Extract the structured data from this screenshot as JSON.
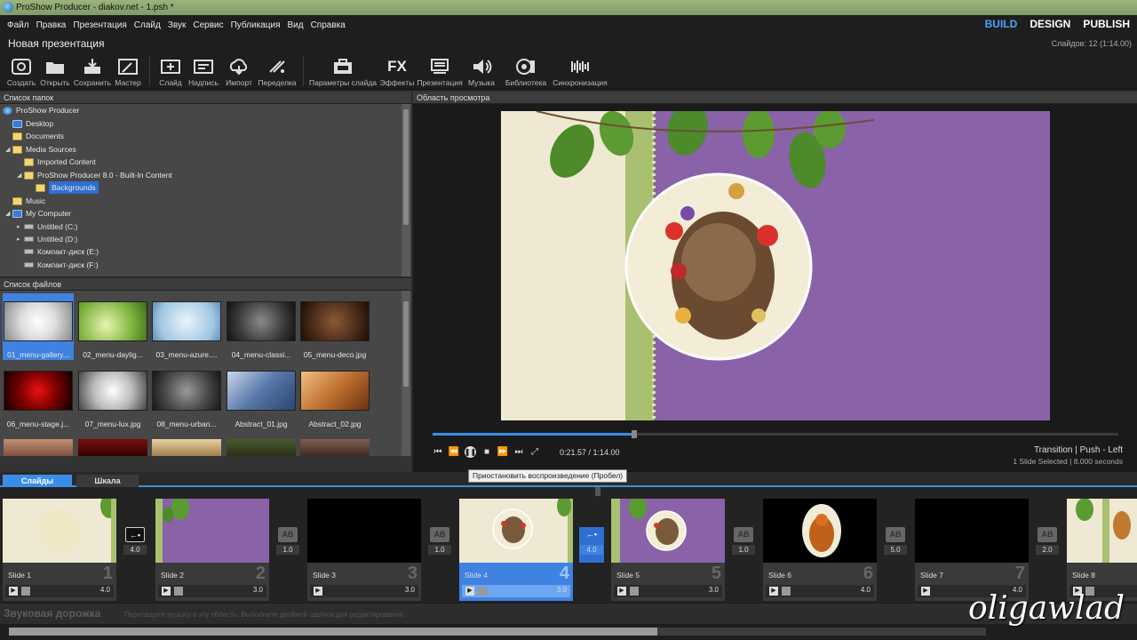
{
  "window": {
    "title": "ProShow Producer - diakov.net - 1.psh *"
  },
  "menu": {
    "items": [
      "Файл",
      "Правка",
      "Презентация",
      "Слайд",
      "Звук",
      "Сервис",
      "Публикация",
      "Вид",
      "Справка"
    ],
    "modes": [
      "BUILD",
      "DESIGN",
      "PUBLISH"
    ],
    "active_mode": "BUILD"
  },
  "show": {
    "title": "Новая презентация",
    "slide_count": "Слайдов: 12 (1:14.00)"
  },
  "toolbar": {
    "buttons": [
      {
        "label": "Создать",
        "icon": "create-icon"
      },
      {
        "label": "Открыть",
        "icon": "open-folder-icon"
      },
      {
        "label": "Сохранить",
        "icon": "save-icon"
      },
      {
        "label": "Мастер",
        "icon": "wizard-icon"
      },
      {
        "label": "Слайд",
        "icon": "add-slide-icon"
      },
      {
        "label": "Надпись",
        "icon": "caption-icon"
      },
      {
        "label": "Импорт",
        "icon": "import-icon"
      },
      {
        "label": "Переделка",
        "icon": "remix-icon"
      },
      {
        "label": "Параметры слайда",
        "icon": "slide-options-icon"
      },
      {
        "label": "Эффекты",
        "icon": "fx-icon"
      },
      {
        "label": "Презентация",
        "icon": "show-options-icon"
      },
      {
        "label": "Музыка",
        "icon": "music-icon"
      },
      {
        "label": "Библиотека",
        "icon": "library-icon"
      },
      {
        "label": "Синхронизация",
        "icon": "sync-icon"
      }
    ]
  },
  "folders": {
    "header": "Список папок",
    "items": [
      "ProShow Producer",
      "Desktop",
      "Documents",
      "Media Sources",
      "Imported Content",
      "ProShow Producer 8.0 - Built-In Content",
      "Backgrounds",
      "Music",
      "My Computer",
      "Untitled (C:)",
      "Untitled (D:)",
      "Компакт-диск (E:)",
      "Компакт-диск (F:)"
    ]
  },
  "files": {
    "header": "Список файлов",
    "items": [
      "01_menu-gallery...",
      "02_menu-daylig...",
      "03_menu-azure....",
      "04_menu-classi...",
      "05_menu-deco.jpg",
      "06_menu-stage.j...",
      "07_menu-lux.jpg",
      "08_menu-urban...",
      "Abstract_01.jpg",
      "Abstract_02.jpg"
    ]
  },
  "preview": {
    "header": "Область просмотра",
    "time": "0:21.57 / 1:14.00",
    "progress": 0.29,
    "transition_label": "Transition",
    "transition_name": "Push - Left",
    "selection_info": "1 Slide Selected",
    "selection_time": "8.000 seconds",
    "tooltip": "Приостановить воспроизведение (Пробел)"
  },
  "tabs": [
    "Слайды",
    "Шкала"
  ],
  "slides": [
    {
      "name": "Slide 1",
      "num": "1",
      "dur": "4.0",
      "trans": "4.0"
    },
    {
      "name": "Slide 2",
      "num": "2",
      "dur": "3.0",
      "trans": "1.0"
    },
    {
      "name": "Slide 3",
      "num": "3",
      "dur": "3.0",
      "trans": "1.0"
    },
    {
      "name": "Slide 4",
      "num": "4",
      "dur": "3.0",
      "trans": "4.0"
    },
    {
      "name": "Slide 5",
      "num": "5",
      "dur": "3.0",
      "trans": "1.0"
    },
    {
      "name": "Slide 6",
      "num": "6",
      "dur": "4.0",
      "trans": "5.0"
    },
    {
      "name": "Slide 7",
      "num": "7",
      "dur": "4.0",
      "trans": "2.0"
    },
    {
      "name": "Slide 8",
      "num": "8",
      "dur": ""
    }
  ],
  "soundtrack": {
    "title": "Звуковая дорожка",
    "hint": "Перетащите музыку в эту область. Выполните двойной щелчок для редактирования."
  },
  "watermark": "oligawlad",
  "colors": {
    "accent": "#3a8eea",
    "preview_purple": "#8a62a8"
  }
}
